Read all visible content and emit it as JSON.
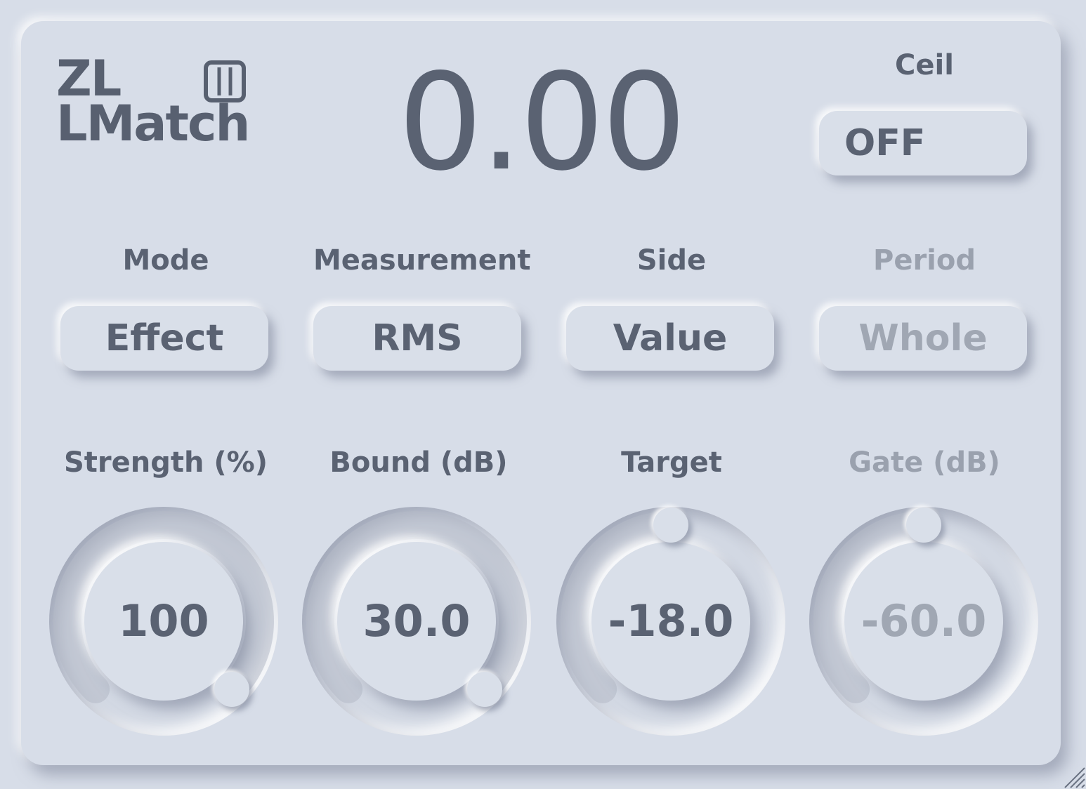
{
  "app": {
    "logo_line1": "ZL",
    "logo_line2": "LMatch",
    "logo_icon": "plugin-window-icon"
  },
  "display": {
    "value": "0.00"
  },
  "ceil": {
    "label": "Ceil",
    "value": "OFF"
  },
  "selectors": [
    {
      "label": "Mode",
      "value": "Effect",
      "enabled": true
    },
    {
      "label": "Measurement",
      "value": "RMS",
      "enabled": true
    },
    {
      "label": "Side",
      "value": "Value",
      "enabled": true
    },
    {
      "label": "Period",
      "value": "Whole",
      "enabled": false
    }
  ],
  "knobs": [
    {
      "label": "Strength (%)",
      "value": "100",
      "fill": 1.0,
      "enabled": true
    },
    {
      "label": "Bound (dB)",
      "value": "30.0",
      "fill": 1.0,
      "enabled": true
    },
    {
      "label": "Target",
      "value": "-18.0",
      "fill": 0.5,
      "enabled": true
    },
    {
      "label": "Gate (dB)",
      "value": "-60.0",
      "fill": 0.5,
      "enabled": false
    }
  ],
  "colors": {
    "background": "#d7dde8",
    "text": "#5a6272",
    "text_disabled": "#9aa1ae",
    "arc": "#b4bac6"
  }
}
